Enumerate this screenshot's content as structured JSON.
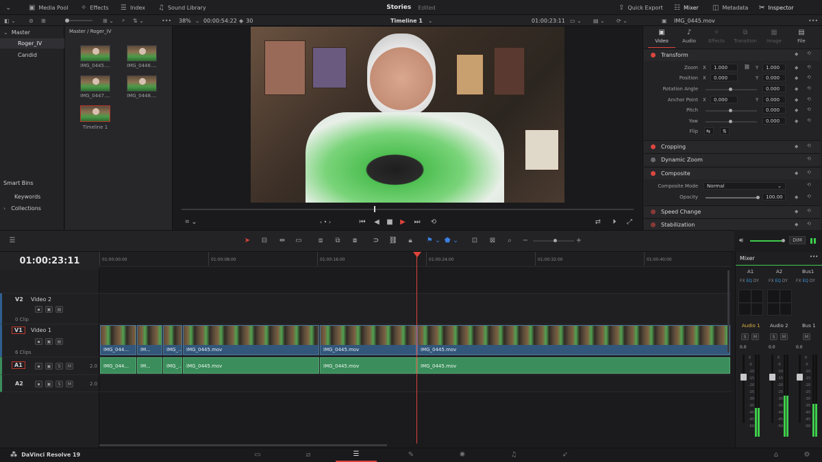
{
  "topbar": {
    "media_pool": "Media Pool",
    "effects": "Effects",
    "index": "Index",
    "sound_library": "Sound Library",
    "project_name": "Stories",
    "project_status": "Edited",
    "quick_export": "Quick Export",
    "mixer": "Mixer",
    "metadata": "Metadata",
    "inspector": "Inspector"
  },
  "viewer_bar": {
    "zoom": "38%",
    "duration": "00:00:54:22",
    "fps": "30",
    "timeline_name": "Timeline 1",
    "timecode": "01:00:23:11",
    "clip_name": "IMG_0445.mov"
  },
  "bins": {
    "master": "Master",
    "items": [
      "Roger_IV",
      "Candid"
    ],
    "smart_bins": "Smart Bins",
    "smart_items": [
      "Keywords",
      "Collections"
    ]
  },
  "pool": {
    "path": "Master / Roger_IV",
    "clips": [
      "IMG_0445....",
      "IMG_0446....",
      "IMG_0447....",
      "IMG_0448....",
      "Timeline 1"
    ]
  },
  "inspector": {
    "tabs": [
      "Video",
      "Audio",
      "Effects",
      "Transition",
      "Image",
      "File"
    ],
    "transform": "Transform",
    "zoom_label": "Zoom",
    "zoom_x": "1.000",
    "zoom_y": "1.000",
    "position_label": "Position",
    "pos_x": "0.000",
    "pos_y": "0.000",
    "rotation_label": "Rotation Angle",
    "rotation": "0.000",
    "anchor_label": "Anchor Point",
    "anchor_x": "0.000",
    "anchor_y": "0.000",
    "pitch_label": "Pitch",
    "pitch": "0.000",
    "yaw_label": "Yaw",
    "yaw": "0.000",
    "flip_label": "Flip",
    "axis_x": "X",
    "axis_y": "Y",
    "cropping": "Cropping",
    "dynamic_zoom": "Dynamic Zoom",
    "composite": "Composite",
    "composite_mode_label": "Composite Mode",
    "composite_mode": "Normal",
    "opacity_label": "Opacity",
    "opacity": "100.00",
    "speed_change": "Speed Change",
    "stabilization": "Stabilization"
  },
  "timeline": {
    "timecode": "01:00:23:11",
    "ruler": [
      "01:00:00:00",
      "01:00:08:00",
      "01:00:16:00",
      "01:00:24:00",
      "01:00:32:00",
      "01:00:40:00"
    ],
    "dim": "DIM",
    "tracks": {
      "v2": {
        "id": "V2",
        "name": "Video 2",
        "count": "0 Clip"
      },
      "v1": {
        "id": "V1",
        "name": "Video 1",
        "count": "6 Clips"
      },
      "a1": {
        "id": "A1",
        "level": "2.0"
      },
      "a2": {
        "id": "A2",
        "level": "2.0"
      }
    },
    "video_clips": [
      "IMG_044...",
      "IM...",
      "IMG_...",
      "IMG_0445.mov",
      "IMG_0445.mov",
      "IMG_0445.mov"
    ],
    "audio_clips": [
      "IMG_044...",
      "IM...",
      "IMG_...",
      "IMG_0445.mov",
      "IMG_0445.mov",
      "IMG_0445.mov"
    ],
    "solo": "S",
    "mute": "M"
  },
  "mixer": {
    "title": "Mixer",
    "channels": [
      "A1",
      "A2",
      "Bus1"
    ],
    "fx": "FX",
    "eq": "EQ",
    "dy": "DY",
    "names": [
      "Audio 1",
      "Audio 2",
      "Bus 1"
    ],
    "level": "0.0",
    "scale": [
      "0",
      "-5",
      "-10",
      "-15",
      "-20",
      "-25",
      "-30",
      "-35",
      "-40",
      "-45",
      "-50"
    ],
    "meter_levels": [
      0.35,
      0.5,
      0.4
    ]
  },
  "app": {
    "name": "DaVinci Resolve 19"
  }
}
